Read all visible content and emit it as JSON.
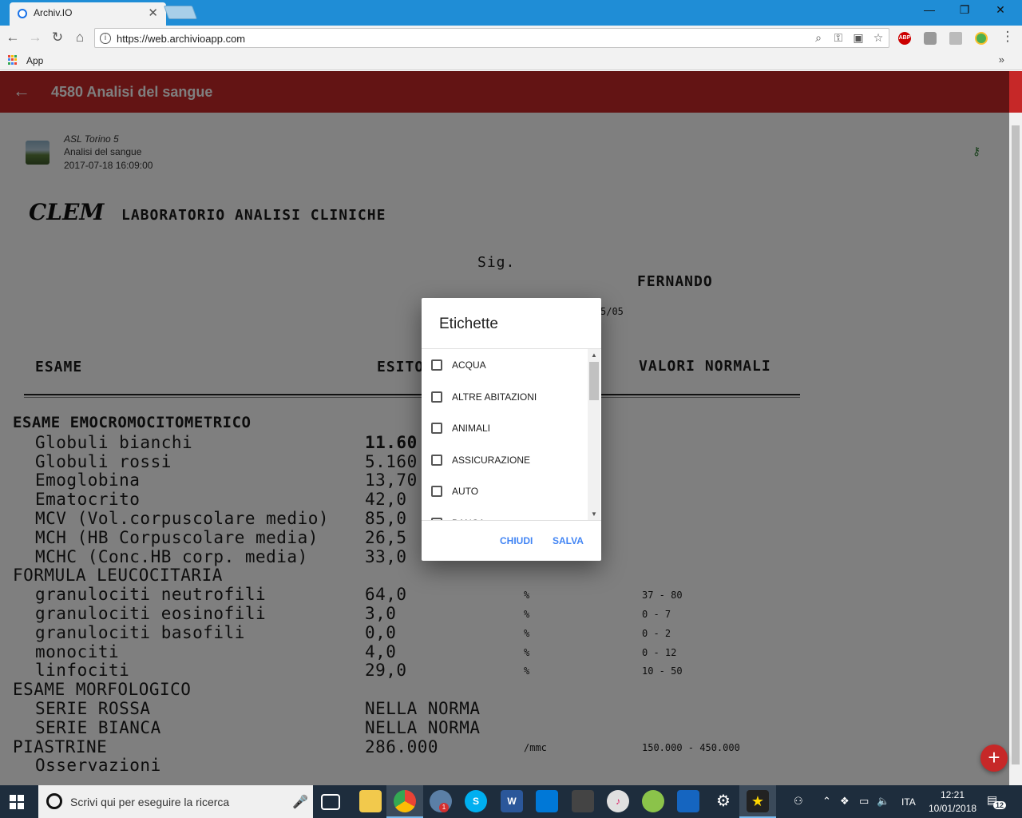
{
  "browser": {
    "tab_title": "Archiv.IO",
    "url": "https://web.archivioapp.com",
    "bookmarks_apps_label": "App",
    "bookmarks_more": "»",
    "ext_abp": "ABP"
  },
  "app": {
    "title": "4580 Analisi del sangue",
    "accent_color": "#c62828"
  },
  "document": {
    "issuer": "ASL Torino 5",
    "type": "Analisi del sangue",
    "datetime": "2017-07-18 16:09:00",
    "scan": {
      "lab_brand": "CLEM",
      "lab_name": "LABORATORIO ANALISI CLINICHE",
      "salutation": "Sig.",
      "patient": "FERNANDO",
      "date_fragment": "5/05",
      "col_esame": "ESAME",
      "col_esito": "ESITO",
      "col_valori": "VALORI NORMALI",
      "rows": [
        {
          "name": "ESAME EMOCROMOCITOMETRICO",
          "value": "",
          "unit": "",
          "range": "",
          "section": true
        },
        {
          "name": "Globuli bianchi",
          "value": "11.60",
          "unit": "",
          "range": ""
        },
        {
          "name": "Globuli rossi",
          "value": "5.160",
          "unit": "",
          "range": ""
        },
        {
          "name": "Emoglobina",
          "value": "13,70",
          "unit": "",
          "range": ""
        },
        {
          "name": "Ematocrito",
          "value": "42,0",
          "unit": "",
          "range": ""
        },
        {
          "name": "MCV (Vol.corpuscolare medio)",
          "value": "85,0",
          "unit": "",
          "range": ""
        },
        {
          "name": "MCH (HB Corpuscolare media)",
          "value": "26,5",
          "unit": "",
          "range": ""
        },
        {
          "name": "MCHC (Conc.HB corp. media)",
          "value": "33,0",
          "unit": "",
          "range": ""
        },
        {
          "name": "FORMULA LEUCOCITARIA",
          "value": "",
          "unit": "",
          "range": "",
          "section": true
        },
        {
          "name": "granulociti neutrofili",
          "value": "64,0",
          "unit": "%",
          "range": "37 - 80"
        },
        {
          "name": "granulociti eosinofili",
          "value": "3,0",
          "unit": "%",
          "range": "0 - 7"
        },
        {
          "name": "granulociti basofili",
          "value": "0,0",
          "unit": "%",
          "range": "0 - 2"
        },
        {
          "name": "monociti",
          "value": "4,0",
          "unit": "%",
          "range": "0 - 12"
        },
        {
          "name": "linfociti",
          "value": "29,0",
          "unit": "%",
          "range": "10 - 50"
        },
        {
          "name": "ESAME MORFOLOGICO",
          "value": "",
          "unit": "",
          "range": "",
          "section": true
        },
        {
          "name": "SERIE ROSSA",
          "value": "NELLA NORMA",
          "unit": "",
          "range": ""
        },
        {
          "name": "SERIE BIANCA",
          "value": "NELLA NORMA",
          "unit": "",
          "range": ""
        },
        {
          "name": "PIASTRINE",
          "value": "286.000",
          "unit": "/mmc",
          "range": "150.000 - 450.000",
          "section": true
        },
        {
          "name": "Osservazioni",
          "value": "",
          "unit": "",
          "range": ""
        }
      ]
    }
  },
  "dialog": {
    "title": "Etichette",
    "items": [
      "ACQUA",
      "ALTRE ABITAZIONI",
      "ANIMALI",
      "ASSICURAZIONE",
      "AUTO",
      "BANCA"
    ],
    "close_label": "CHIUDI",
    "save_label": "SALVA"
  },
  "taskbar": {
    "search_placeholder": "Scrivi qui per eseguire la ricerca",
    "language": "ITA",
    "time": "12:21",
    "date": "10/01/2018",
    "notification_count": "12",
    "mail_badge": "1"
  }
}
